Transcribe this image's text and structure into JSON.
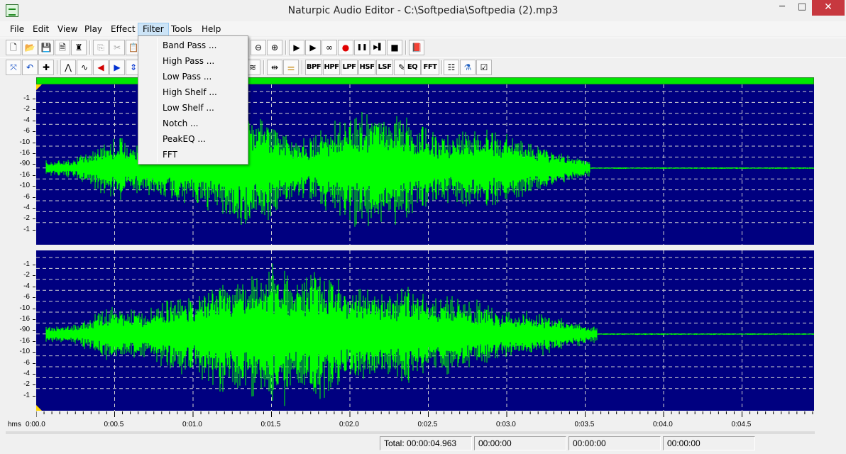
{
  "window": {
    "title": "Naturpic Audio Editor - C:\\Softpedia\\Softpedia (2).mp3",
    "minimize": "─",
    "maximize": "□",
    "close": "✕"
  },
  "menu": [
    "File",
    "Edit",
    "View",
    "Play",
    "Effect",
    "Filter",
    "Tools",
    "Help"
  ],
  "filter_menu": [
    "Band Pass ...",
    "High Pass ...",
    "Low Pass ...",
    "High Shelf ...",
    "Low Shelf ...",
    "Notch ...",
    "PeakEQ ...",
    "FFT"
  ],
  "toolbar1": [
    {
      "name": "new-file-icon",
      "glyph": "🗋"
    },
    {
      "name": "open-folder-icon",
      "glyph": "📂"
    },
    {
      "name": "save-icon",
      "glyph": "💾"
    },
    {
      "name": "properties-icon",
      "glyph": "🗎"
    },
    {
      "name": "metronome-icon",
      "glyph": "♜"
    },
    {
      "name": "copy-icon",
      "glyph": "⎘"
    },
    {
      "name": "cut-icon",
      "glyph": "✂"
    },
    {
      "name": "paste-icon",
      "glyph": "📋"
    },
    {
      "name": "zoom-out-icon",
      "glyph": "⊖"
    },
    {
      "name": "zoom-fit-icon",
      "glyph": "⊕"
    },
    {
      "name": "play-icon",
      "glyph": "▶"
    },
    {
      "name": "play-circle-icon",
      "glyph": "▶"
    },
    {
      "name": "loop-icon",
      "glyph": "∞"
    },
    {
      "name": "record-icon",
      "glyph": "●"
    },
    {
      "name": "pause-icon",
      "glyph": "❚❚"
    },
    {
      "name": "step-icon",
      "glyph": "▶▌"
    },
    {
      "name": "stop-icon",
      "glyph": "■"
    },
    {
      "name": "book-icon",
      "glyph": "📕"
    }
  ],
  "toolbar2": [
    {
      "name": "select-all-icon",
      "glyph": "⤧"
    },
    {
      "name": "undo-icon",
      "glyph": "↶"
    },
    {
      "name": "trim-icon",
      "glyph": "✚"
    },
    {
      "name": "fade-in-icon",
      "glyph": "⋀"
    },
    {
      "name": "normalize-icon",
      "glyph": "∿"
    },
    {
      "name": "reverse-icon",
      "glyph": "◀"
    },
    {
      "name": "forward-icon",
      "glyph": "▶"
    },
    {
      "name": "stereo-icon",
      "glyph": "⇕"
    },
    {
      "name": "amplify-icon",
      "glyph": "≋"
    },
    {
      "name": "split-icon",
      "glyph": "⇹"
    },
    {
      "name": "mixer-icon",
      "glyph": "⚌"
    }
  ],
  "filter_buttons": [
    "BPF",
    "HPF",
    "LPF",
    "HSF",
    "LSF",
    "✎",
    "EQ",
    "FFT",
    "☷",
    "⚗",
    "☑"
  ],
  "db_labels_ch1": [
    "-1",
    "-2",
    "-4",
    "-6",
    "-10",
    "-16",
    "-90",
    "-16",
    "-10",
    "-6",
    "-4",
    "-2",
    "-1"
  ],
  "db_labels_ch2": [
    "-1",
    "-2",
    "-4",
    "-6",
    "-10",
    "-16",
    "-90",
    "-16",
    "-10",
    "-6",
    "-4",
    "-2",
    "-1"
  ],
  "ruler": {
    "unit": "hms",
    "labels": [
      "0:00.0",
      "0:00.5",
      "0:01.0",
      "0:01.5",
      "0:02.0",
      "0:02.5",
      "0:03.0",
      "0:03.5",
      "0:04.0",
      "0:04.5"
    ]
  },
  "status": {
    "total": "Total: 00:00:04.963",
    "t1": "00:00:00",
    "t2": "00:00:00",
    "t3": "00:00:00"
  },
  "colors": {
    "wave_bg": "#000080",
    "wave": "#00ff00",
    "grid": "#d0d0d0"
  }
}
